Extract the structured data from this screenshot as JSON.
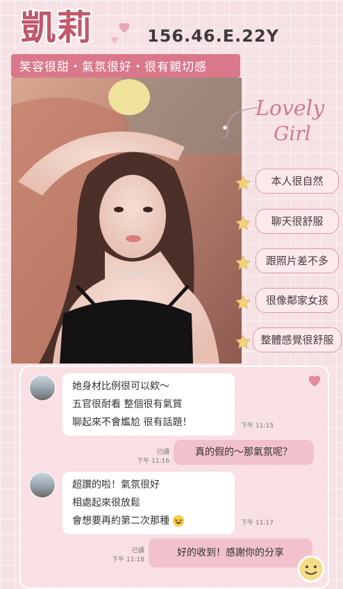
{
  "header": {
    "name": "凱莉",
    "stats": "156.46.E.22Y",
    "tagline": "笑容很甜・氣氛很好・很有親切感"
  },
  "photo": {
    "alt": "photo of girl"
  },
  "lovely_text": {
    "line1": "Lovely",
    "line2": "Girl"
  },
  "tags": [
    "本人很自然",
    "聊天很舒服",
    "跟照片差不多",
    "很像鄰家女孩",
    "整體感覺很舒服"
  ],
  "chat": {
    "msg1": {
      "lines": [
        "她身材比例很可以欸～",
        "五官很耐看 整個很有氣質",
        "聊起來不會尷尬 很有話題！"
      ],
      "time": "下午 11:15"
    },
    "reply1": {
      "text": "真的假的～那氣氛呢？",
      "read": "已讀",
      "time": "下午 11:16"
    },
    "msg2": {
      "lines": [
        "超讚的啦！氣氛很好",
        "相處起來很放鬆",
        "會想要再約第二次那種"
      ],
      "time": "下午 11:17"
    },
    "reply2": {
      "text": "好的收到！感謝你的分享",
      "read": "已讀",
      "time": "下午 11:18"
    }
  },
  "colors": {
    "accent": "#d9788a",
    "name": "#c2576a",
    "background": "#f6e2e5"
  }
}
